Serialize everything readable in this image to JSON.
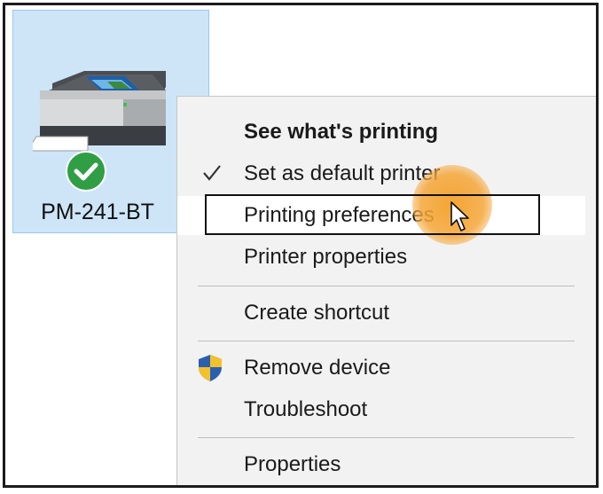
{
  "printer": {
    "name": "PM-241-BT",
    "icon": "printer-icon",
    "status_icon": "default-check-icon",
    "status_color": "#2f9e44"
  },
  "context_menu": {
    "items": [
      {
        "label": "See what's printing",
        "bold": true
      },
      {
        "label": "Set as default printer",
        "icon": "checkmark-icon",
        "checked": true
      },
      {
        "label": "Printing preferences",
        "state": "hovered",
        "highlighted": true
      },
      {
        "label": "Printer properties"
      },
      {
        "label": "Create shortcut"
      },
      {
        "label": "Remove device",
        "icon": "uac-shield-icon"
      },
      {
        "label": "Troubleshoot"
      },
      {
        "label": "Properties"
      }
    ]
  },
  "colors": {
    "selection_background": "#cde5f7",
    "selection_border": "#99c9ef",
    "menu_background": "#f2f2f2",
    "hover_background": "#ffffff",
    "click_indicator": "#f4a028"
  }
}
